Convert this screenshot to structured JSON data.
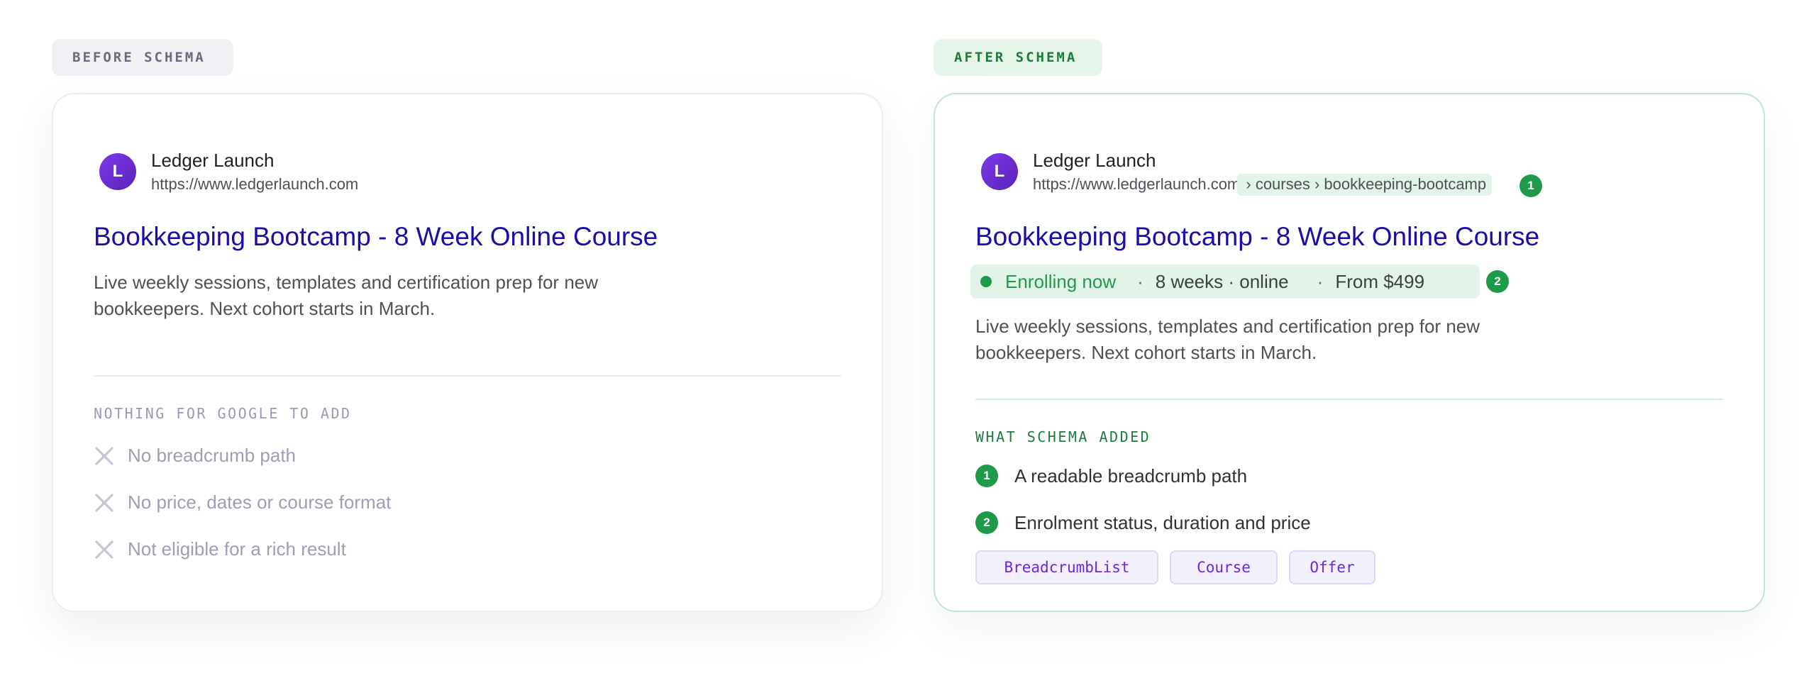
{
  "before": {
    "label": "BEFORE SCHEMA",
    "site_name": "Ledger Launch",
    "avatar_letter": "L",
    "url": "https://www.ledgerlaunch.com",
    "title": "Bookkeeping Bootcamp - 8 Week Online Course",
    "snippet": "Live weekly sessions, templates and certification prep for new bookkeepers. Next cohort starts in March.",
    "section_heading": "NOTHING FOR GOOGLE TO ADD",
    "missing": [
      "No breadcrumb path",
      "No price, dates or course format",
      "Not eligible for a rich result"
    ]
  },
  "after": {
    "label": "AFTER SCHEMA",
    "site_name": "Ledger Launch",
    "avatar_letter": "L",
    "url": "https://www.ledgerlaunch.com",
    "breadcrumb": " › courses › bookkeeping-bootcamp",
    "title": "Bookkeeping Bootcamp - 8 Week Online Course",
    "rich_status": "Enrolling now",
    "rich_separator": "·",
    "rich_format": "8 weeks · online",
    "rich_price": "From $499",
    "snippet": "Live weekly sessions, templates and certification prep for new bookkeepers. Next cohort starts in March.",
    "section_heading": "WHAT SCHEMA ADDED",
    "added": [
      {
        "number": "1",
        "text": "A readable breadcrumb path"
      },
      {
        "number": "2",
        "text": "Enrolment status, duration and price"
      }
    ],
    "tags": [
      "BreadcrumbList",
      "Course",
      "Offer"
    ]
  },
  "colors": {
    "link_blue": "#1a0dab",
    "accent_green": "#1e9a4a",
    "avatar_purple": "#6d28d9",
    "highlight_green": "#e2f4e7"
  }
}
